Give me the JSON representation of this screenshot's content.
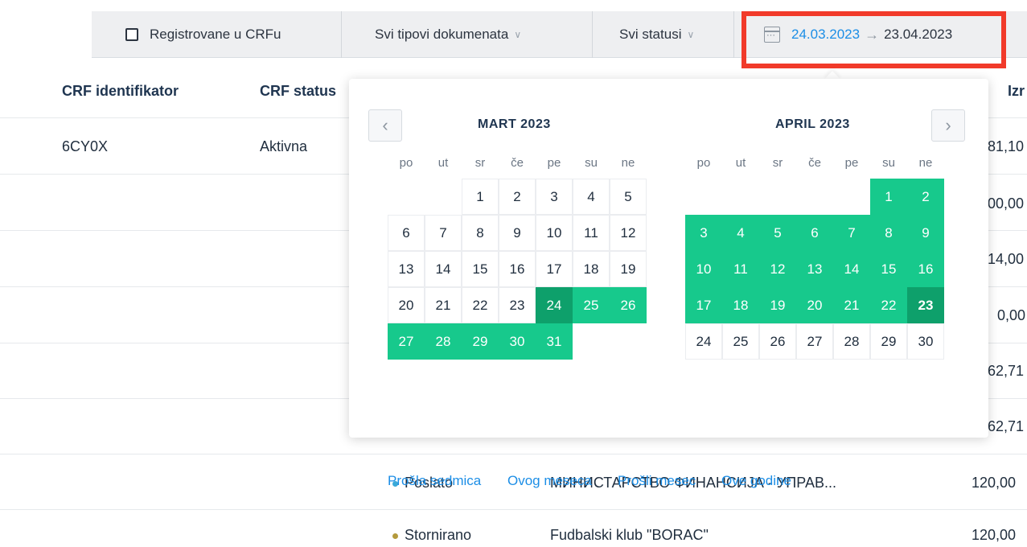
{
  "filters": {
    "registered_label": "Registrovane u CRFu",
    "doc_types_label": "Svi tipovi dokumenata",
    "statuses_label": "Svi statusi",
    "date_from": "24.03.2023",
    "date_to": "23.04.2023",
    "arrow": "→"
  },
  "table": {
    "headers": {
      "crf_id": "CRF identifikator",
      "crf_status": "CRF status",
      "amount": "Izr"
    },
    "row1": {
      "crf_id": "6CY0X",
      "crf_status": "Aktivna"
    },
    "amounts": [
      "81,10",
      "00,00",
      "14,00",
      "0,00",
      "62,71",
      "62,71",
      "120,00",
      "120,00"
    ],
    "row7": {
      "status": "Poslato",
      "partner": "МИНИСТАРСТВО ФИНАНСИЈА - УПРАВ..."
    },
    "row8": {
      "status": "Stornirano",
      "partner": "Fudbalski klub \"BORAC\""
    },
    "status_colors": {
      "poslato": "#3aa9d8",
      "stornirano": "#b49a3c"
    }
  },
  "calendar": {
    "prev_icon": "chevron-left-icon",
    "next_icon": "chevron-right-icon",
    "weekdays": [
      "po",
      "ut",
      "sr",
      "če",
      "pe",
      "su",
      "ne"
    ],
    "left": {
      "title": "MART 2023",
      "days": [
        "1",
        "2",
        "3",
        "4",
        "5",
        "6",
        "7",
        "8",
        "9",
        "10",
        "11",
        "12",
        "13",
        "14",
        "15",
        "16",
        "17",
        "18",
        "19",
        "20",
        "21",
        "22",
        "23",
        "24",
        "25",
        "26",
        "27",
        "28",
        "29",
        "30",
        "31"
      ]
    },
    "right": {
      "title": "APRIL 2023",
      "days": [
        "1",
        "2",
        "3",
        "4",
        "5",
        "6",
        "7",
        "8",
        "9",
        "10",
        "11",
        "12",
        "13",
        "14",
        "15",
        "16",
        "17",
        "18",
        "19",
        "20",
        "21",
        "22",
        "23",
        "24",
        "25",
        "26",
        "27",
        "28",
        "29",
        "30"
      ]
    },
    "quick": {
      "last_week": "Prošla sedmica",
      "this_month": "Ovog meseca",
      "last_month": "Prošli mesec",
      "this_year": "Ove godine"
    },
    "colors": {
      "range": "#17c98c",
      "range_edge": "#0ea06b",
      "link": "#1c8ee6",
      "highlight": "#f13a2a"
    }
  }
}
